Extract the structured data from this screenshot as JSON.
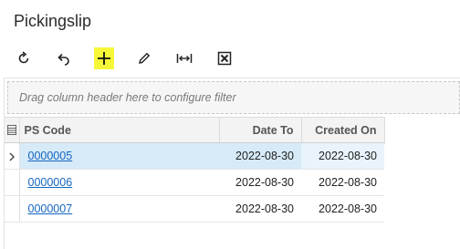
{
  "page": {
    "title": "Pickingslip"
  },
  "toolbar": {
    "buttons": [
      {
        "name": "refresh-button",
        "icon": "refresh-icon"
      },
      {
        "name": "undo-button",
        "icon": "undo-icon"
      },
      {
        "name": "add-button",
        "icon": "plus-icon",
        "highlighted": true
      },
      {
        "name": "edit-button",
        "icon": "pencil-icon"
      },
      {
        "name": "fit-columns-button",
        "icon": "fit-width-icon"
      },
      {
        "name": "export-excel-button",
        "icon": "excel-icon"
      }
    ],
    "highlight_color": "#f7f73a"
  },
  "grid": {
    "group_placeholder": "Drag column header here to configure filter",
    "columns": {
      "code": "PS Code",
      "date_to": "Date To",
      "created_on": "Created On"
    },
    "rows": [
      {
        "code": "0000005",
        "date_to": "2022-08-30",
        "created_on": "2022-08-30",
        "selected": true
      },
      {
        "code": "0000006",
        "date_to": "2022-08-30",
        "created_on": "2022-08-30",
        "selected": false
      },
      {
        "code": "0000007",
        "date_to": "2022-08-30",
        "created_on": "2022-08-30",
        "selected": false
      }
    ],
    "colors": {
      "link": "#1565c0",
      "selected_row": "#d7eaf8"
    }
  }
}
